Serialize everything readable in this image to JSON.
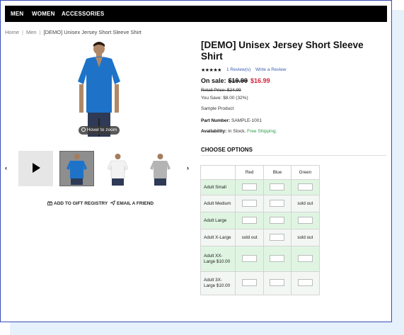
{
  "nav": {
    "items": [
      "MEN",
      "WOMEN",
      "ACCESSORIES"
    ]
  },
  "breadcrumb": {
    "items": [
      "Home",
      "Men",
      "[DEMO] Unisex Jersey Short Sleeve Shirt"
    ]
  },
  "gallery": {
    "zoom_label": "Hover to zoom",
    "prev_arrow": "‹",
    "next_arrow": "›"
  },
  "actions": {
    "gift_registry": "ADD TO GIFT REGISTRY",
    "email_friend": "EMAIL A FRIEND"
  },
  "product": {
    "title": "[DEMO] Unisex Jersey Short Sleeve Shirt",
    "stars": "★★★★★",
    "reviews_link": "1 Review(s)",
    "write_review": "Write a Review",
    "sale_label": "On sale:",
    "old_price": "$19.99",
    "sale_price": "$16.99",
    "retail_label": "Retail Price:",
    "retail_price": "$24.99",
    "you_save": "You Save: $8.00 (32%)",
    "sample_text": "Sample Product",
    "part_label": "Part Number:",
    "part_value": "SAMPLE-1001",
    "avail_label": "Availability:",
    "avail_value": "In Stock.",
    "shipping": "Free Shipping."
  },
  "options": {
    "heading": "CHOOSE OPTIONS",
    "columns": [
      "Red",
      "Blue",
      "Green"
    ],
    "rows": [
      {
        "label": "Adult Small",
        "cells": [
          "input",
          "input",
          "input"
        ]
      },
      {
        "label": "Adult Medium",
        "cells": [
          "input",
          "input",
          "sold out"
        ]
      },
      {
        "label": "Adult Large",
        "cells": [
          "input",
          "input",
          "input"
        ]
      },
      {
        "label": "Adult X-Large",
        "cells": [
          "sold out",
          "input",
          "sold out"
        ]
      },
      {
        "label": "Adult XX-Large $10.00",
        "cells": [
          "input",
          "input",
          "input"
        ]
      },
      {
        "label": "Adult 3X-Large $10.00",
        "cells": [
          "input",
          "input",
          "input"
        ]
      }
    ]
  },
  "colors": {
    "shirt_main": "#1e73c8",
    "sale_red": "#d2233a",
    "link_blue": "#3b5fae",
    "stock_green": "#2b9a4a"
  }
}
